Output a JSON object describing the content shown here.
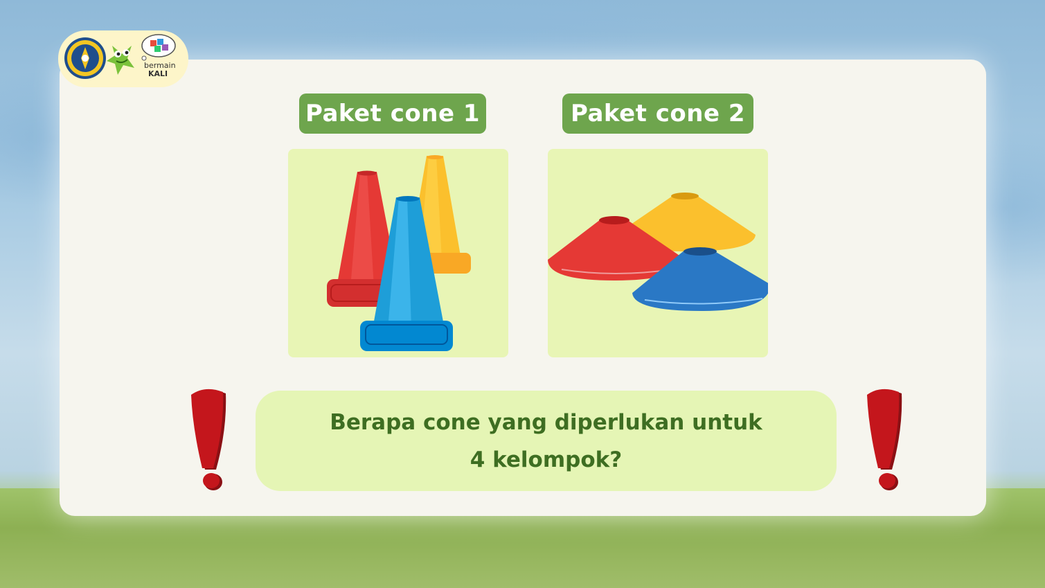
{
  "logo": {
    "line1": "bermain",
    "line2": "KALI"
  },
  "packages": [
    {
      "title": "Paket cone 1"
    },
    {
      "title": "Paket cone 2"
    }
  ],
  "question": {
    "line1": "Berapa cone yang diperlukan untuk",
    "line2": "4 kelompok?"
  },
  "colors": {
    "title_bg": "#6ea54d",
    "box_bg": "#e8f5b5",
    "question_text": "#3e6e22",
    "cone_red": "#e53935",
    "cone_yellow": "#fbc02d",
    "cone_blue": "#1e9ed8",
    "exclaim_red": "#c4161c"
  }
}
